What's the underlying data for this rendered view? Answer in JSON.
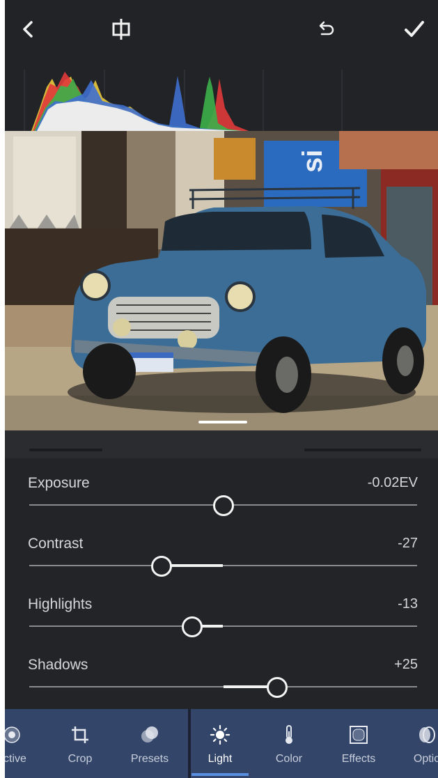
{
  "toolbar": {
    "back_icon": "chevron-left-icon",
    "compare_icon": "compare-icon",
    "undo_icon": "undo-icon",
    "done_icon": "checkmark-icon"
  },
  "adjustments": [
    {
      "label": "Exposure",
      "value": "-0.02EV",
      "position": 0.5
    },
    {
      "label": "Contrast",
      "value": "-27",
      "position": 0.342
    },
    {
      "label": "Highlights",
      "value": "-13",
      "position": 0.42
    },
    {
      "label": "Shadows",
      "value": "+25",
      "position": 0.64
    }
  ],
  "tabs": [
    {
      "label": "ective",
      "icon": "selective-icon",
      "active": false
    },
    {
      "label": "Crop",
      "icon": "crop-icon",
      "active": false
    },
    {
      "label": "Presets",
      "icon": "presets-icon",
      "active": false
    },
    {
      "label": "Light",
      "icon": "sun-icon",
      "active": true
    },
    {
      "label": "Color",
      "icon": "thermometer-icon",
      "active": false
    },
    {
      "label": "Effects",
      "icon": "effects-icon",
      "active": false
    },
    {
      "label": "Optio",
      "icon": "optics-icon",
      "active": false
    }
  ],
  "colors": {
    "panel_bg": "#232428",
    "tabbar_bg": "#33466a",
    "active_indicator": "#5a8ee0",
    "histogram_red": "#e03a3a",
    "histogram_green": "#3cb04a",
    "histogram_blue": "#3f6fd0",
    "histogram_yellow": "#e2c23a"
  }
}
